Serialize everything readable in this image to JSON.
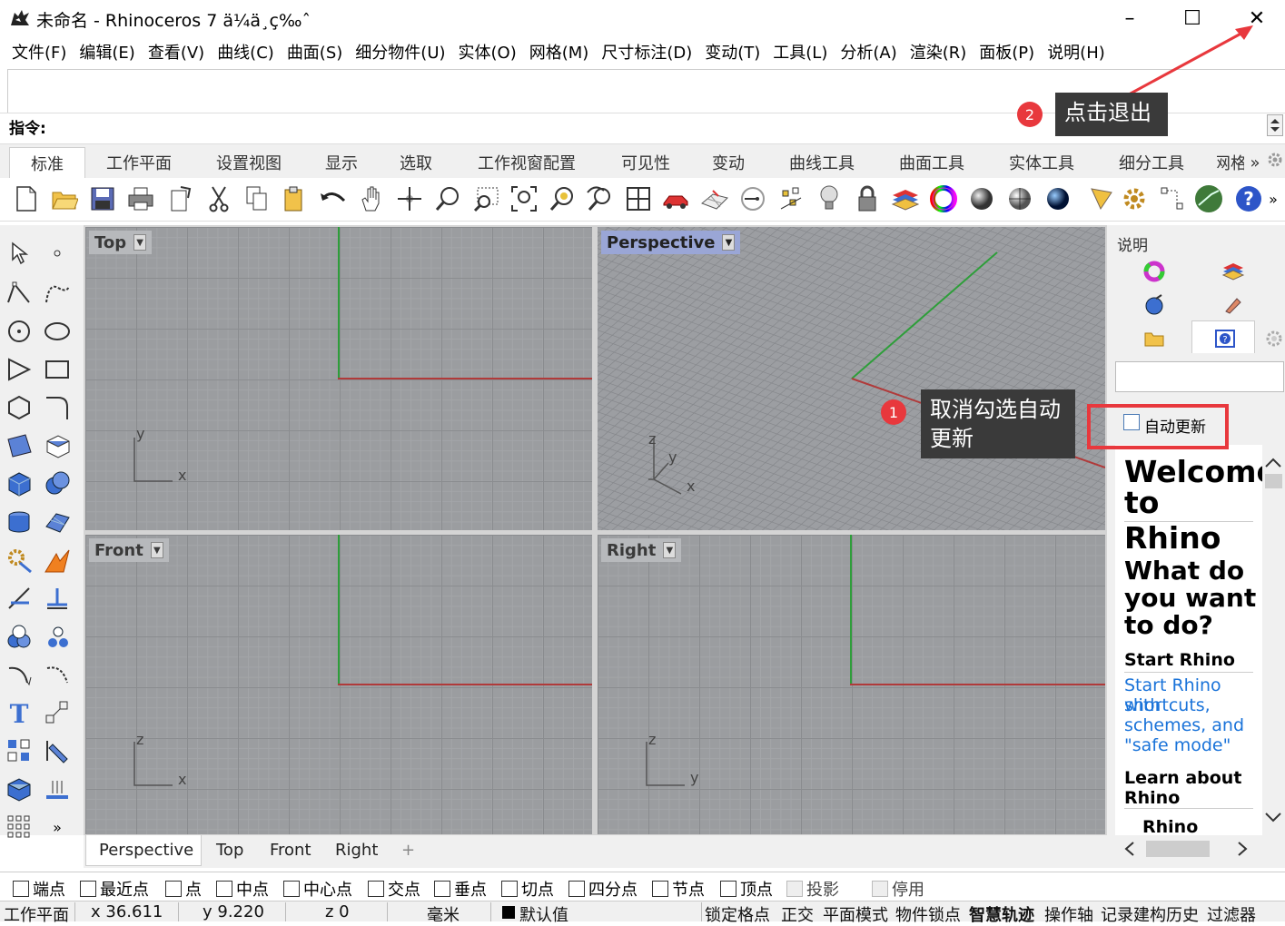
{
  "window": {
    "title": "未命名 - Rhinoceros 7 ä¼ä¸ç‰ˆ",
    "minimize": "–",
    "maximize": "☐",
    "close": "✕"
  },
  "menu": [
    "文件(F)",
    "编辑(E)",
    "查看(V)",
    "曲线(C)",
    "曲面(S)",
    "细分物件(U)",
    "实体(O)",
    "网格(M)",
    "尺寸标注(D)",
    "变动(T)",
    "工具(L)",
    "分析(A)",
    "渲染(R)",
    "面板(P)",
    "说明(H)"
  ],
  "command": {
    "label": "指令:"
  },
  "tabs": [
    "标准",
    "工作平面",
    "设置视图",
    "显示",
    "选取",
    "工作视窗配置",
    "可见性",
    "变动",
    "曲线工具",
    "曲面工具",
    "实体工具",
    "细分工具",
    "网格",
    "»"
  ],
  "viewports": {
    "top": {
      "label": "Top",
      "axes": [
        "y",
        "x"
      ]
    },
    "perspective": {
      "label": "Perspective",
      "axes": [
        "z",
        "y",
        "x"
      ]
    },
    "front": {
      "label": "Front",
      "axes": [
        "z",
        "x"
      ]
    },
    "right": {
      "label": "Right",
      "axes": [
        "z",
        "y"
      ]
    }
  },
  "viewport_tabs": [
    "Perspective",
    "Top",
    "Front",
    "Right",
    "+"
  ],
  "right_panel": {
    "title": "说明",
    "auto_update": "自动更新",
    "welcome": {
      "heading1": "Welcome",
      "heading2": "to Rhino",
      "q1": "What do",
      "q2": "you want",
      "q3": "to do?",
      "start": "Start Rhino",
      "link1": "Start Rhino with",
      "link2": "shortcuts,",
      "link3": "schemes, and",
      "link4": "\"safe mode\"",
      "learn1": "Learn about",
      "learn2": "Rhino",
      "basics": "Rhino basics"
    }
  },
  "annotations": {
    "step1": {
      "num": "1",
      "text1": "取消勾选自动",
      "text2": "更新"
    },
    "step2": {
      "num": "2",
      "text": "点击退出"
    },
    "color": "#e8383d"
  },
  "osnaps": [
    {
      "label": "端点",
      "disabled": false
    },
    {
      "label": "最近点",
      "disabled": false
    },
    {
      "label": "点",
      "disabled": false
    },
    {
      "label": "中点",
      "disabled": false
    },
    {
      "label": "中心点",
      "disabled": false
    },
    {
      "label": "交点",
      "disabled": false
    },
    {
      "label": "垂点",
      "disabled": false
    },
    {
      "label": "切点",
      "disabled": false
    },
    {
      "label": "四分点",
      "disabled": false
    },
    {
      "label": "节点",
      "disabled": false
    },
    {
      "label": "顶点",
      "disabled": false
    },
    {
      "label": "投影",
      "disabled": true
    },
    {
      "label": "停用",
      "disabled": true
    }
  ],
  "status": {
    "cplane": "工作平面",
    "x": "x 36.611",
    "y": "y 9.220",
    "z": "z 0",
    "units": "毫米",
    "layer": "默认值",
    "grid_snap": "锁定格点",
    "ortho": "正交",
    "planar": "平面模式",
    "osnap": "物件锁点",
    "smarttrack": "智慧轨迹",
    "gumball": "操作轴",
    "history": "记录建构历史",
    "filter": "过滤器"
  }
}
